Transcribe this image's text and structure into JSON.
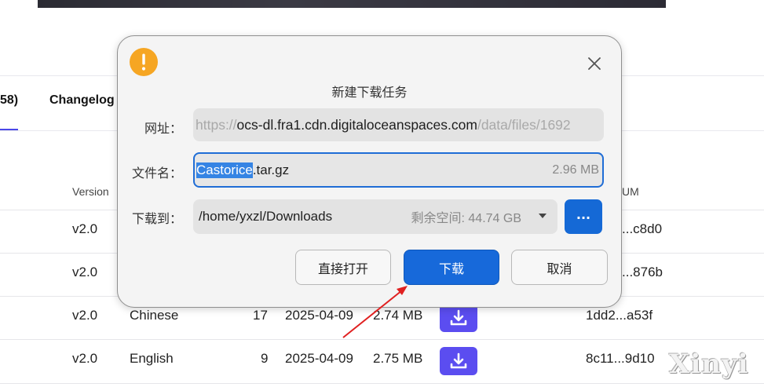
{
  "background": {
    "tabs": [
      "58)",
      "Changelog"
    ],
    "headers": [
      "Version",
      "UM"
    ],
    "header_fragment_left": ")",
    "rows": [
      {
        "version": "v2.0",
        "language": "",
        "count": "",
        "date": "",
        "size": "",
        "checksum": "...c8d0"
      },
      {
        "version": "v2.0",
        "language": "",
        "count": "",
        "date": "",
        "size": "",
        "checksum": "...876b"
      },
      {
        "version": "v2.0",
        "language": "Chinese",
        "count": "17",
        "date": "2025-04-09",
        "size": "2.74 MB",
        "checksum": "1dd2...a53f"
      },
      {
        "version": "v2.0",
        "language": "English",
        "count": "9",
        "date": "2025-04-09",
        "size": "2.75 MB",
        "checksum": "8c11...9d10"
      }
    ],
    "watermark": "Xinyi"
  },
  "dialog": {
    "title": "新建下载任务",
    "icon": "warning-icon",
    "url_label": "网址：",
    "url_prefix": "https://",
    "url_host": "ocs-dl.fra1.cdn.digitaloceanspaces.com",
    "url_path": "/data/files/1692",
    "filename_label": "文件名：",
    "filename_selected": "Castorice",
    "filename_ext": ".tar.gz",
    "file_size": "2.96 MB",
    "saveto_label": "下载到：",
    "path": "/home/yxzl/Downloads",
    "free_space": "剩余空间: 44.74 GB",
    "browse_label": "...",
    "open_direct_label": "直接打开",
    "download_label": "下载",
    "cancel_label": "取消"
  },
  "colors": {
    "accent": "#1769da",
    "warning": "#f6a623",
    "download_button": "#5b4df0",
    "annotation_arrow": "#e02020"
  }
}
